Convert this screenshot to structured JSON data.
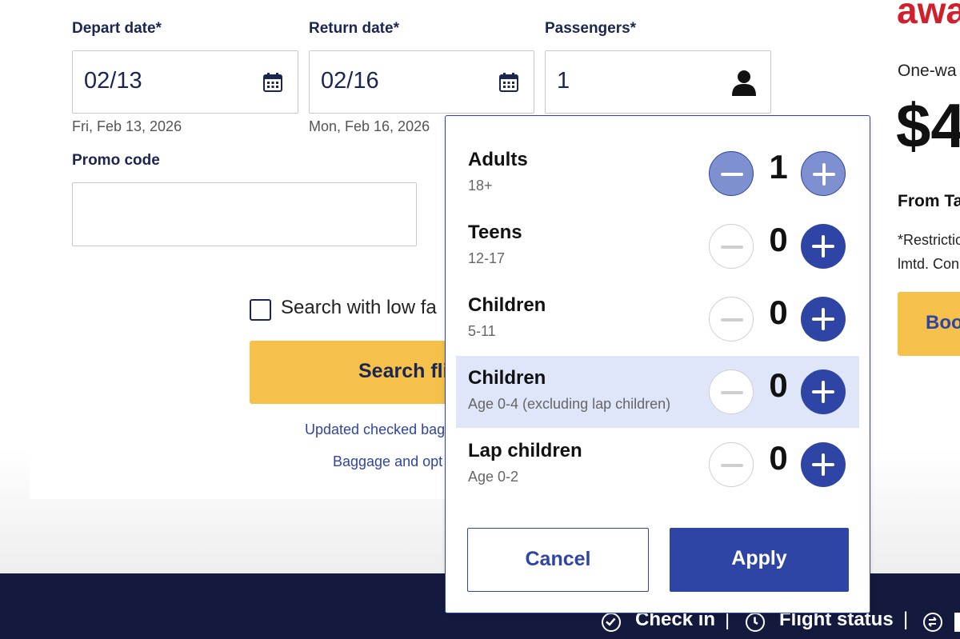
{
  "form": {
    "depart_label": "Depart date*",
    "depart_value": "02/13",
    "depart_sub": "Fri, Feb 13, 2026",
    "return_label": "Return date*",
    "return_value": "02/16",
    "return_sub": "Mon, Feb 16, 2026",
    "passengers_label": "Passengers*",
    "passengers_value": "1",
    "promo_label": "Promo code",
    "promo_value": "",
    "low_fare_label": "Search with low fa",
    "search_button": "Search fli",
    "link1": "Updated checked bag",
    "link2": "Baggage and opt"
  },
  "right_panel": {
    "title": "awa",
    "one_way": "One-wa",
    "price": "$4",
    "from": "From Ta",
    "restriction1": "*Restrictio",
    "restriction2": "lmtd. Con",
    "book_button": "Boo"
  },
  "passenger_popup": {
    "rows": [
      {
        "name": "Adults",
        "sub": "18+",
        "count": "1"
      },
      {
        "name": "Teens",
        "sub": "12-17",
        "count": "0"
      },
      {
        "name": "Children",
        "sub": "5-11",
        "count": "0"
      },
      {
        "name": "Children",
        "sub": "Age 0-4 (excluding lap children)",
        "count": "0"
      },
      {
        "name": "Lap children",
        "sub": "Age 0-2",
        "count": "0"
      }
    ],
    "cancel": "Cancel",
    "apply": "Apply"
  },
  "footer": {
    "check_in": "Check in",
    "flight_status": "Flight status",
    "sep": "|"
  },
  "colors": {
    "brand_blue": "#2f45a6",
    "navy": "#1a2552",
    "yellow": "#f5c14b",
    "red": "#d21f2b",
    "footer_bg": "#141a3d",
    "highlight_row": "#dfe6f9"
  }
}
